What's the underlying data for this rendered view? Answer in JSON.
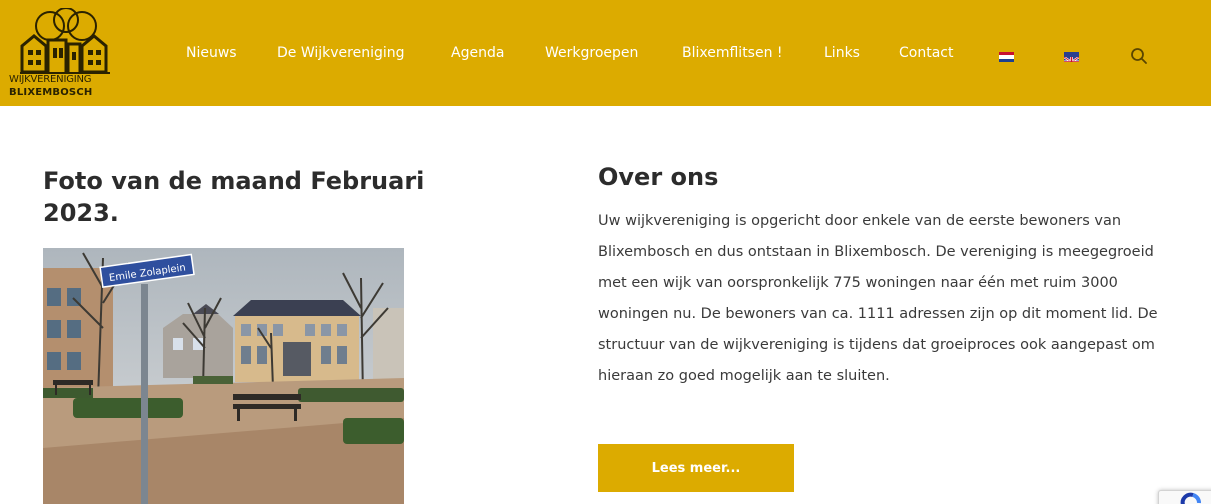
{
  "header": {
    "logo": {
      "line1": "WIJKVERENIGING",
      "line2": "BLIXEMBOSCH"
    },
    "nav": [
      {
        "label": "Nieuws"
      },
      {
        "label": "De Wijkvereniging"
      },
      {
        "label": "Agenda"
      },
      {
        "label": "Werkgroepen"
      },
      {
        "label": "Blixemflitsen !"
      },
      {
        "label": "Links"
      },
      {
        "label": "Contact"
      }
    ],
    "languages": [
      "nl-flag-icon",
      "uk-flag-icon"
    ],
    "search_icon": "search-icon",
    "accent_color": "#dcab00"
  },
  "photo_section": {
    "title": "Foto van de maand Februari 2023.",
    "sign_text": "Emile Zolaplein"
  },
  "about_section": {
    "title": "Over ons",
    "body": "Uw wijkvereniging is opgericht door enkele van de eerste bewoners van Blixembosch en dus ontstaan in Blixembosch. De vereniging is meegegroeid met een wijk van oorspronkelijk 775 woningen naar één met ruim 3000 woningen nu. De bewoners van ca. 1111 adressen zijn op dit moment lid. De structuur van de wijkvereniging is tijdens dat groeiproces ook aangepast om hieraan zo goed mogelijk aan te sluiten.",
    "button_label": "Lees meer..."
  }
}
